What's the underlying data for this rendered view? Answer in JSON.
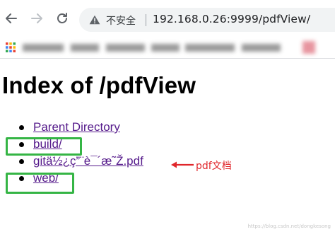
{
  "browser": {
    "security_label": "不安全",
    "url": "192.168.0.26:9999/pdfView/"
  },
  "page": {
    "title": "Index of /pdfView",
    "entries": [
      {
        "label": "Parent Directory"
      },
      {
        "label": "build/"
      },
      {
        "label": "gitä½¿ç”¨è¯´æ˜Ž.pdf"
      },
      {
        "label": "web/"
      }
    ]
  },
  "annotation": {
    "text": "pdf文档",
    "color": "#e0262b",
    "highlight_color": "#35b545"
  },
  "watermark": "https://blog.csdn.net/dongkesong"
}
